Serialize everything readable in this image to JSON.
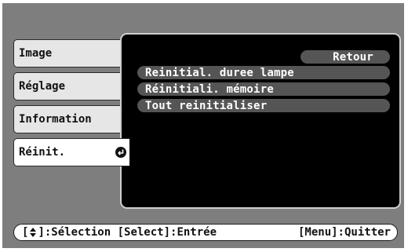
{
  "tabs": [
    {
      "label": "Image"
    },
    {
      "label": "Réglage"
    },
    {
      "label": "Information"
    },
    {
      "label": "Réinit."
    }
  ],
  "menu": {
    "return_label": "Retour",
    "items": [
      {
        "label": "Reinitial. duree lampe"
      },
      {
        "label": "Réinitiali. mémoire"
      },
      {
        "label": "Tout reinitialiser"
      }
    ]
  },
  "status": {
    "bracket_open": "[",
    "nav_icon": "up-down-arrow-icon",
    "select_text": "]:Sélection [Select]:Entrée",
    "quit_text": "[Menu]:Quitter"
  }
}
